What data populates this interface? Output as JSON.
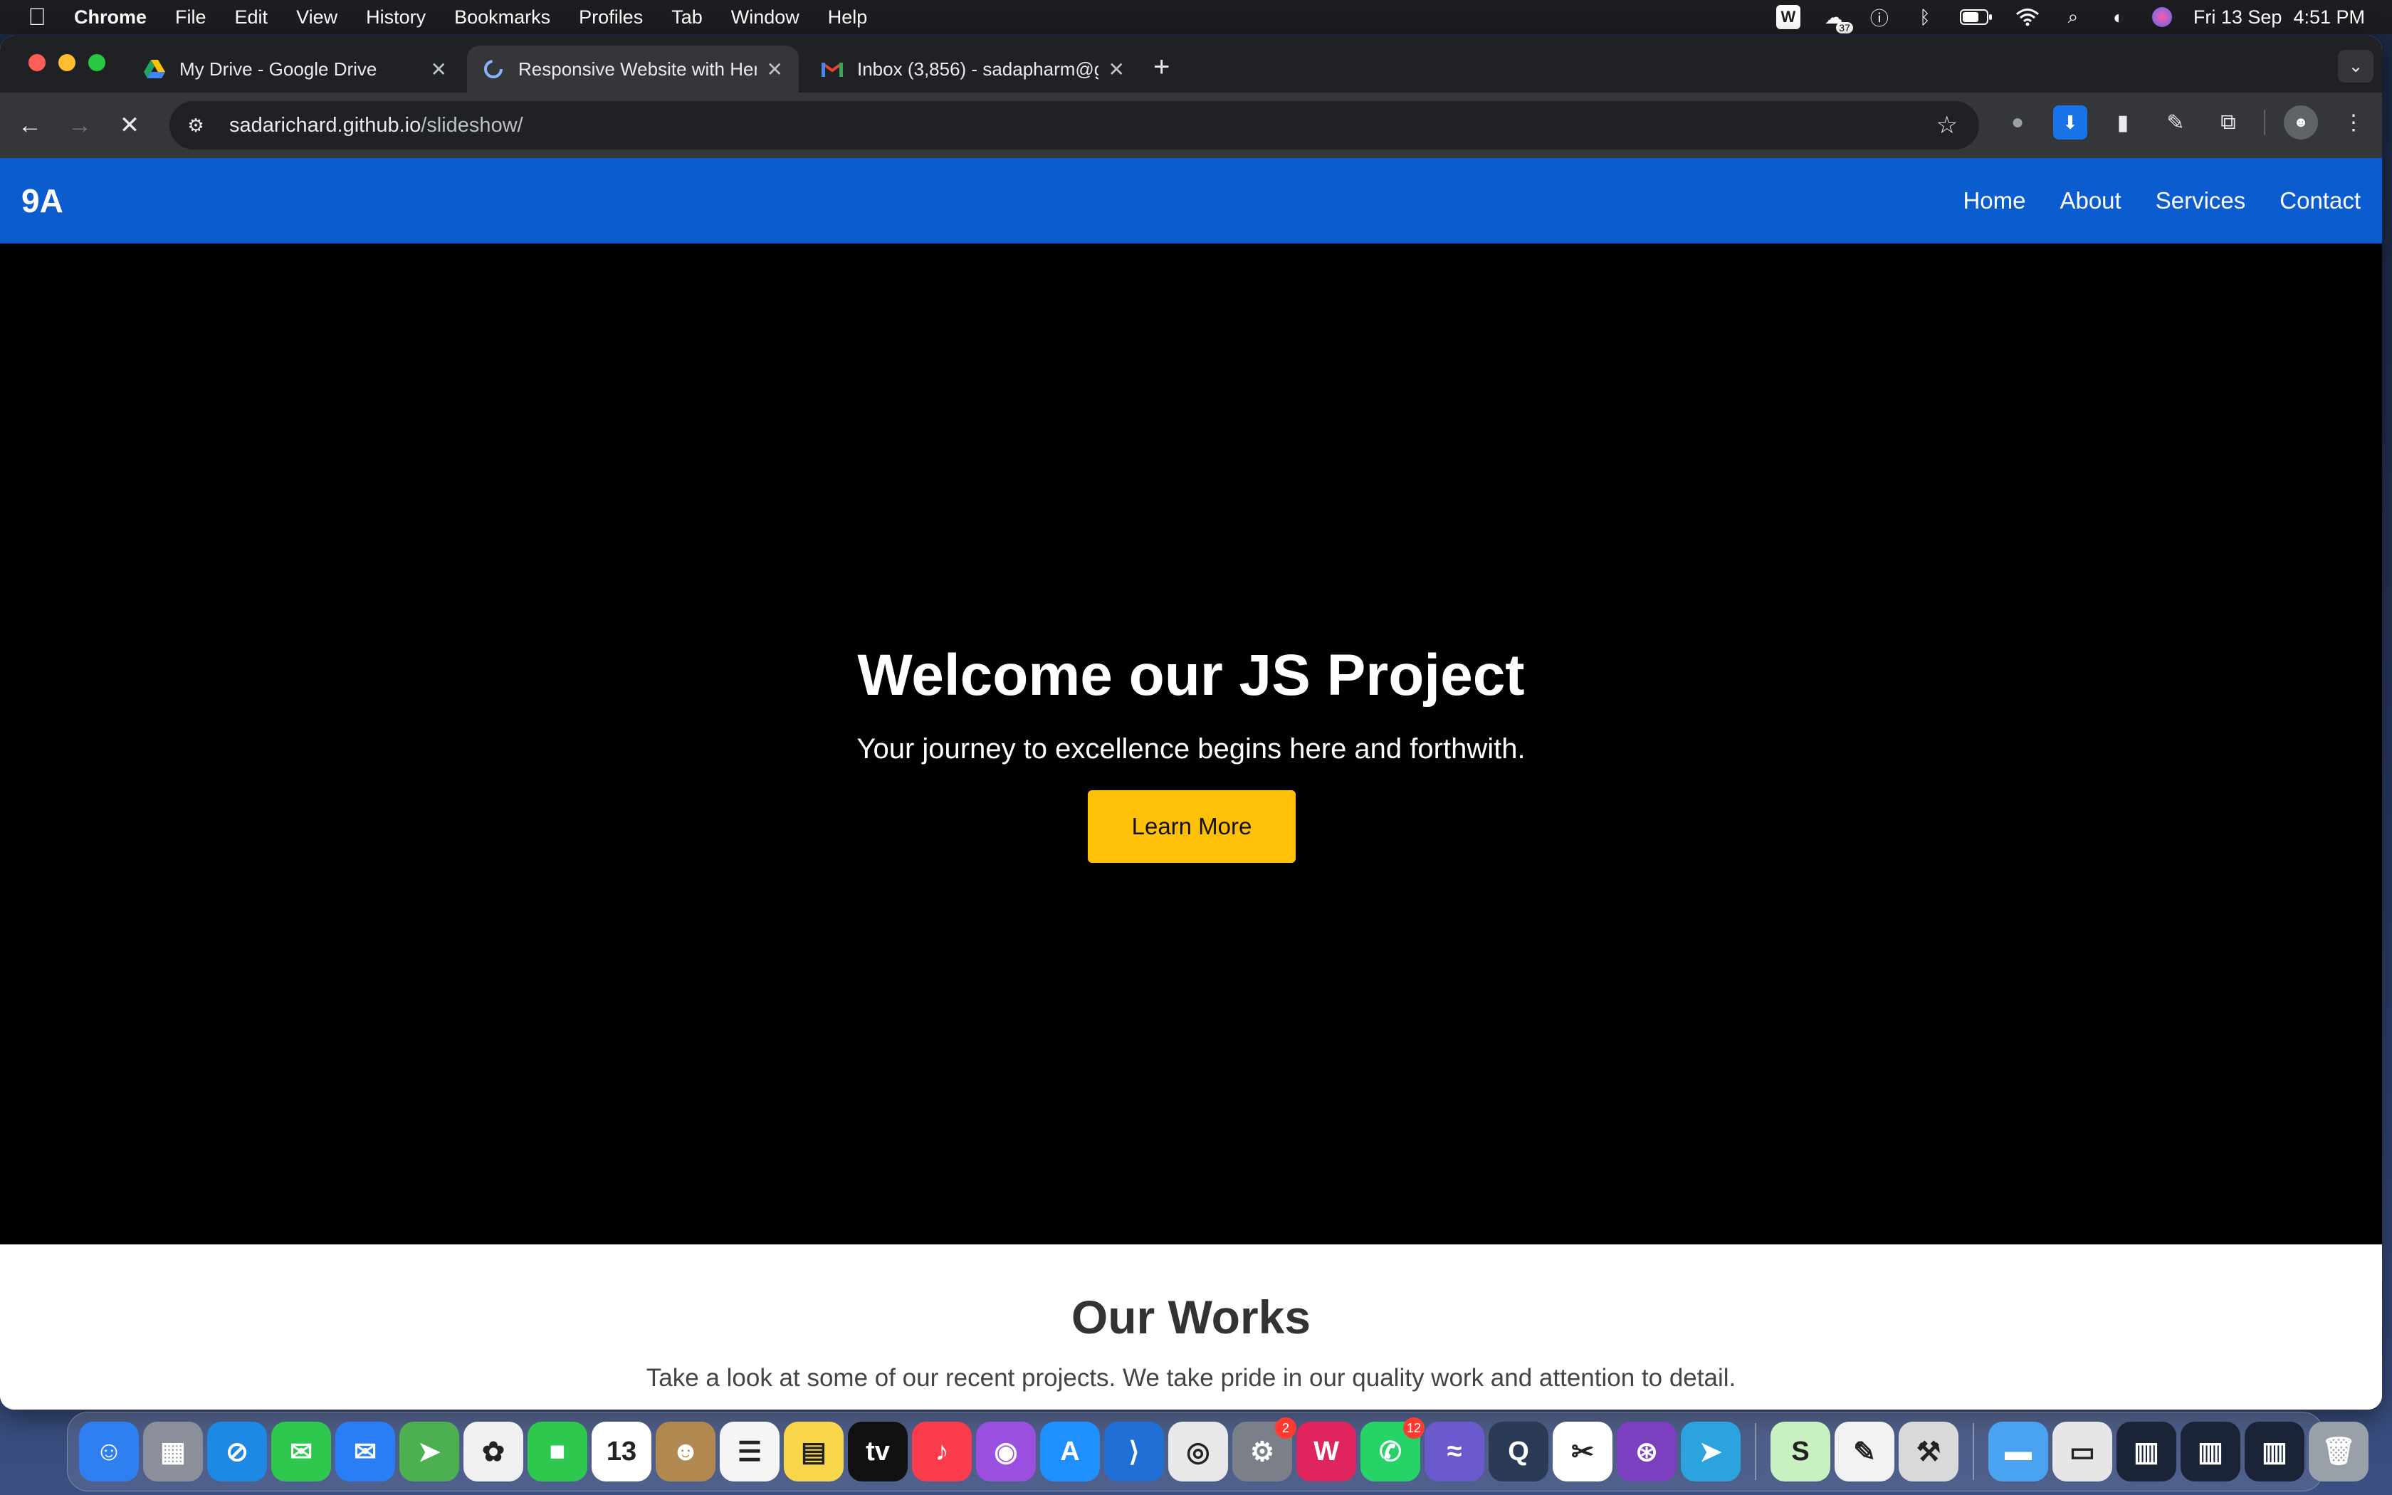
{
  "menubar": {
    "app_name": "Chrome",
    "items": [
      "File",
      "Edit",
      "View",
      "History",
      "Bookmarks",
      "Profiles",
      "Tab",
      "Window",
      "Help"
    ],
    "status_badge": "37",
    "date": "Fri 13 Sep",
    "time": "4:51 PM"
  },
  "browser": {
    "tabs": [
      {
        "title": "My Drive - Google Drive",
        "icon": "google-drive-icon"
      },
      {
        "title": "Responsive Website with Her",
        "icon": "loading-spinner-icon"
      },
      {
        "title": "Inbox (3,856) - sadapharm@g",
        "icon": "gmail-icon"
      }
    ],
    "new_tab_label": "+",
    "url_host": "sadarichard.github.io",
    "url_path": "/slideshow/"
  },
  "site": {
    "logo": "9A",
    "nav": [
      "Home",
      "About",
      "Services",
      "Contact"
    ],
    "hero": {
      "title": "Welcome our JS Project",
      "subtitle": "Your journey to excellence begins here and forthwith.",
      "cta": "Learn More"
    },
    "works": {
      "title": "Our Works",
      "subtitle": "Take a look at some of our recent projects. We take pride in our quality work and attention to detail."
    }
  },
  "dock": {
    "apps": [
      {
        "name": "finder",
        "glyph": "☺",
        "color": "#2f7ff0"
      },
      {
        "name": "launchpad",
        "glyph": "▦",
        "color": "#8a8f99"
      },
      {
        "name": "safari",
        "glyph": "⊘",
        "color": "#1e88e5"
      },
      {
        "name": "messages",
        "glyph": "✉",
        "color": "#2ec84f"
      },
      {
        "name": "mail",
        "glyph": "✉",
        "color": "#2a7ef5"
      },
      {
        "name": "maps",
        "glyph": "➤",
        "color": "#4caf50"
      },
      {
        "name": "photos",
        "glyph": "✿",
        "color": "#f0f0f0"
      },
      {
        "name": "facetime",
        "glyph": "■",
        "color": "#2ec84f"
      },
      {
        "name": "calendar",
        "glyph": "13",
        "color": "#ffffff"
      },
      {
        "name": "contacts",
        "glyph": "☻",
        "color": "#b08850"
      },
      {
        "name": "reminders",
        "glyph": "☰",
        "color": "#f5f5f5"
      },
      {
        "name": "notes",
        "glyph": "▤",
        "color": "#f9d649"
      },
      {
        "name": "apple-tv",
        "glyph": "tv",
        "color": "#111111"
      },
      {
        "name": "music",
        "glyph": "♪",
        "color": "#fa3c4c"
      },
      {
        "name": "podcasts",
        "glyph": "◉",
        "color": "#9b4fe0"
      },
      {
        "name": "app-store",
        "glyph": "A",
        "color": "#1e90ff"
      },
      {
        "name": "vscode",
        "glyph": "⟩",
        "color": "#1f6fd6"
      },
      {
        "name": "chrome",
        "glyph": "◎",
        "color": "#e8e8e8"
      },
      {
        "name": "system-settings",
        "glyph": "⚙",
        "color": "#7a7f88",
        "badge": "2"
      },
      {
        "name": "wps-office",
        "glyph": "W",
        "color": "#e0245e"
      },
      {
        "name": "whatsapp",
        "glyph": "✆",
        "color": "#25d366",
        "badge": "12"
      },
      {
        "name": "cloud-app",
        "glyph": "≈",
        "color": "#6a5acd"
      },
      {
        "name": "quicktime",
        "glyph": "Q",
        "color": "#2b3a55"
      },
      {
        "name": "capcut",
        "glyph": "✂",
        "color": "#ffffff"
      },
      {
        "name": "github-desktop",
        "glyph": "⊛",
        "color": "#7b3fbf"
      },
      {
        "name": "telegram",
        "glyph": "➤",
        "color": "#2aa3de"
      },
      {
        "name": "sheets-app",
        "glyph": "S",
        "color": "#c9f0c0"
      },
      {
        "name": "textedit",
        "glyph": "✎",
        "color": "#f2f2f2"
      },
      {
        "name": "automator",
        "glyph": "⚒",
        "color": "#d9d9d9"
      },
      {
        "name": "downloads-folder",
        "glyph": "▬",
        "color": "#4aa3f0"
      },
      {
        "name": "window-preview-1",
        "glyph": "▭",
        "color": "#e6e6e6"
      },
      {
        "name": "window-preview-2",
        "glyph": "▥",
        "color": "#1a2436"
      },
      {
        "name": "window-preview-3",
        "glyph": "▥",
        "color": "#1a2436"
      },
      {
        "name": "window-preview-4",
        "glyph": "▥",
        "color": "#1a2436"
      },
      {
        "name": "trash",
        "glyph": "🗑",
        "color": "#9aa0a8"
      }
    ]
  },
  "colors": {
    "site_nav": "#0b5ccf",
    "cta": "#ffc107",
    "hero_bg": "#000000"
  }
}
